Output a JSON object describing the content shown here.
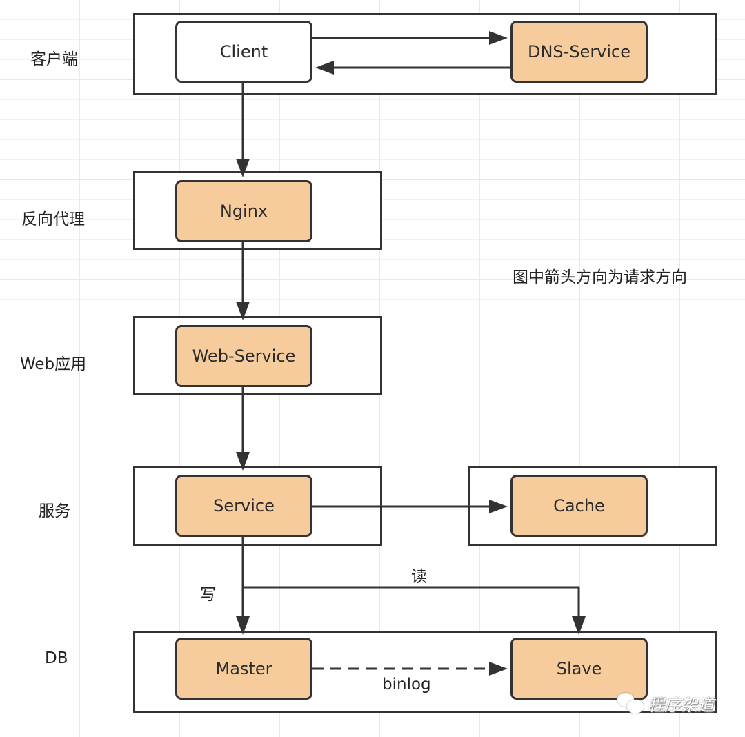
{
  "diagram": {
    "note": "图中箭头方向为请求方向",
    "layers": [
      {
        "id": "client",
        "label": "客户端"
      },
      {
        "id": "proxy",
        "label": "反向代理"
      },
      {
        "id": "web",
        "label": "Web应用"
      },
      {
        "id": "service",
        "label": "服务"
      },
      {
        "id": "db",
        "label": "DB"
      }
    ],
    "nodes": {
      "client": "Client",
      "dns": "DNS-Service",
      "nginx": "Nginx",
      "web_service": "Web-Service",
      "service": "Service",
      "cache": "Cache",
      "master": "Master",
      "slave": "Slave"
    },
    "edges": [
      {
        "from": "Client",
        "to": "DNS-Service",
        "style": "solid"
      },
      {
        "from": "DNS-Service",
        "to": "Client",
        "style": "solid"
      },
      {
        "from": "Client",
        "to": "Nginx",
        "style": "solid"
      },
      {
        "from": "Nginx",
        "to": "Web-Service",
        "style": "solid"
      },
      {
        "from": "Web-Service",
        "to": "Service",
        "style": "solid"
      },
      {
        "from": "Service",
        "to": "Cache",
        "style": "solid"
      },
      {
        "from": "Service",
        "to": "Master",
        "style": "solid",
        "label": "写"
      },
      {
        "from": "Service",
        "to": "Slave",
        "style": "solid",
        "label": "读"
      },
      {
        "from": "Master",
        "to": "Slave",
        "style": "dashed",
        "label": "binlog"
      }
    ],
    "edge_labels": {
      "write": "写",
      "read": "读",
      "binlog": "binlog"
    },
    "colors": {
      "node_fill": "#f6cc9c",
      "stroke": "#333333"
    },
    "watermark": "程序架道"
  }
}
